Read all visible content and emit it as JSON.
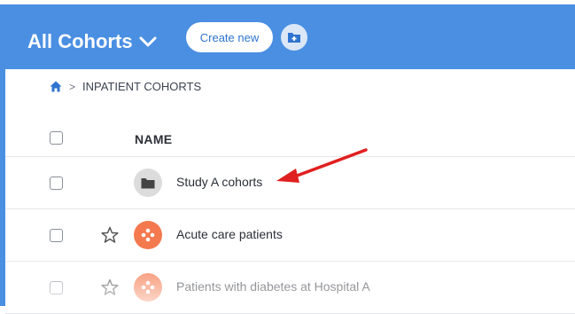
{
  "header": {
    "title": "All Cohorts",
    "create_label": "Create new",
    "accent": "#4a8fe2"
  },
  "breadcrumb": {
    "home_icon": "home-icon",
    "separator": ">",
    "current": "INPATIENT COHORTS"
  },
  "table": {
    "column_name": "NAME",
    "rows": [
      {
        "label": "Study A cohorts",
        "type": "folder",
        "starred": false
      },
      {
        "label": "Acute care patients",
        "type": "cohort",
        "starred": false
      },
      {
        "label": "Patients with diabetes at Hospital A",
        "type": "cohort",
        "starred": false
      }
    ]
  },
  "annotation": {
    "type": "arrow",
    "color": "#e02020"
  }
}
